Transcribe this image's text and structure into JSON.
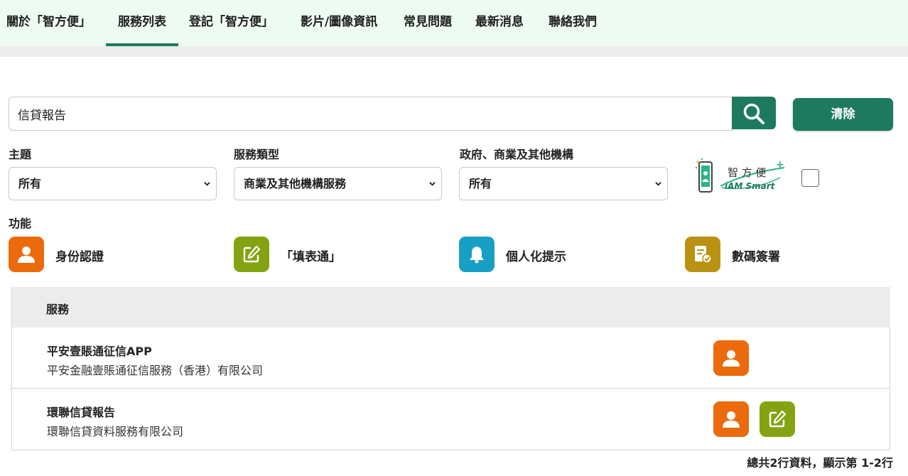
{
  "nav": {
    "items": [
      {
        "label": "關於「智方便」"
      },
      {
        "label": "服務列表"
      },
      {
        "label": "登記「智方便」"
      },
      {
        "label": "影片/圖像資訊"
      },
      {
        "label": "常見問題"
      },
      {
        "label": "最新消息"
      },
      {
        "label": "聯絡我們"
      }
    ],
    "active_index": 1,
    "active_color": "#1d7a5f"
  },
  "search": {
    "value": "信貸報告",
    "button_icon": "search-icon",
    "clear_label": "清除"
  },
  "filters": {
    "topic": {
      "label": "主題",
      "selected": "所有"
    },
    "service_type": {
      "label": "服務類型",
      "selected": "商業及其他機構服務"
    },
    "organization": {
      "label": "政府、商業及其他機構",
      "selected": "所有"
    },
    "logo_text": {
      "cn": "智 方 便",
      "en": "iAM Smart"
    }
  },
  "functions": {
    "label": "功能",
    "items": [
      {
        "label": "身份認證",
        "icon": "person-icon",
        "color": "#ea6a0c"
      },
      {
        "label": "「填表通」",
        "icon": "edit-form-icon",
        "color": "#84a312"
      },
      {
        "label": "個人化提示",
        "icon": "bell-icon",
        "color": "#18a0c4"
      },
      {
        "label": "數碼簽署",
        "icon": "signed-document-icon",
        "color": "#b99211"
      }
    ]
  },
  "table": {
    "header": "服務",
    "rows": [
      {
        "name": "平安壹賬通征信APP",
        "org": "平安金融壹賬通征信服務（香港）有限公司",
        "icons": [
          "person-icon"
        ]
      },
      {
        "name": "環聯信貸報告",
        "org": "環聯信貸資料服務有限公司",
        "icons": [
          "person-icon",
          "edit-form-icon"
        ]
      }
    ]
  },
  "footer": {
    "count_text": "總共2行資料，顯示第 1-2行"
  },
  "colors": {
    "primary": "#1d7a5f",
    "nav_bg": "#eefbf3"
  }
}
